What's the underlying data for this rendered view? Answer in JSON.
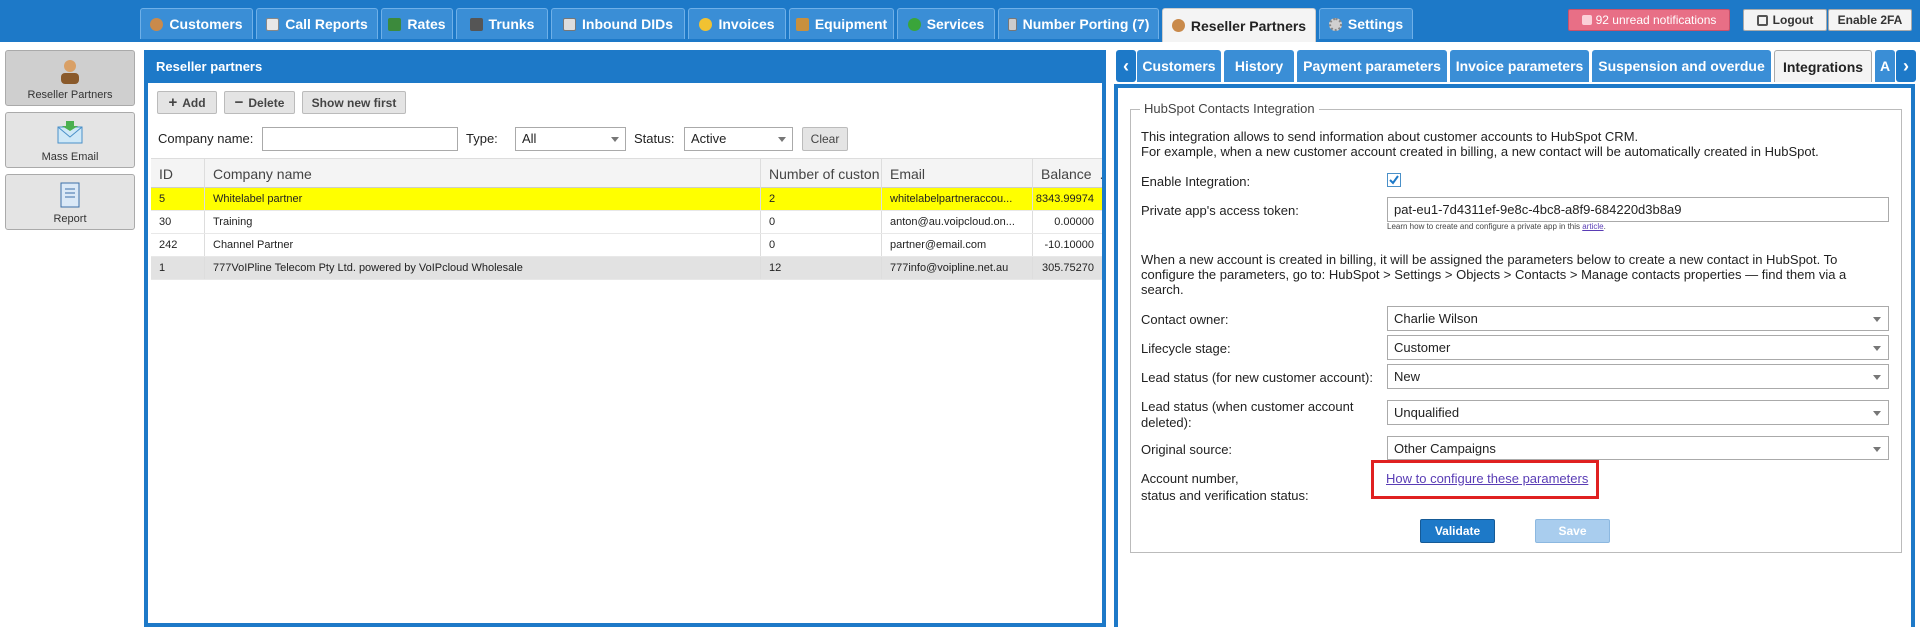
{
  "nav": {
    "tabs": [
      {
        "label": "Customers",
        "icon": "person-icon"
      },
      {
        "label": "Call Reports",
        "icon": "report-icon"
      },
      {
        "label": "Rates",
        "icon": "rates-icon"
      },
      {
        "label": "Trunks",
        "icon": "trunks-icon"
      },
      {
        "label": "Inbound DIDs",
        "icon": "list-icon"
      },
      {
        "label": "Invoices",
        "icon": "coins-icon"
      },
      {
        "label": "Equipment",
        "icon": "box-icon"
      },
      {
        "label": "Services",
        "icon": "refresh-icon"
      },
      {
        "label": "Number Porting (7)",
        "icon": "phone-icon"
      },
      {
        "label": "Reseller Partners",
        "icon": "person-icon"
      },
      {
        "label": "Settings",
        "icon": "gear-icon"
      }
    ],
    "active_tab": "Reseller Partners",
    "notifications": "92 unread notifications",
    "logout": "Logout",
    "enable_2fa": "Enable 2FA"
  },
  "sidebar": {
    "items": [
      {
        "label": "Reseller Partners"
      },
      {
        "label": "Mass Email"
      },
      {
        "label": "Report"
      }
    ]
  },
  "list_panel": {
    "title": "Reseller partners",
    "toolbar": {
      "add": "Add",
      "delete": "Delete",
      "show_new_first": "Show new first"
    },
    "filters": {
      "company_label": "Company name:",
      "company_value": "",
      "type_label": "Type:",
      "type_value": "All",
      "status_label": "Status:",
      "status_value": "Active",
      "clear": "Clear"
    },
    "columns": [
      "ID",
      "Company name",
      "Number of custon",
      "Email",
      "Balance"
    ],
    "rows": [
      {
        "id": "5",
        "company": "Whitelabel partner",
        "customers": "2",
        "email": "whitelabelpartneraccou...",
        "balance": "8343.99974"
      },
      {
        "id": "30",
        "company": "Training",
        "customers": "0",
        "email": "anton@au.voipcloud.on...",
        "balance": "0.00000"
      },
      {
        "id": "242",
        "company": "Channel Partner",
        "customers": "0",
        "email": "partner@email.com",
        "balance": "-10.10000"
      },
      {
        "id": "1",
        "company": "777VoIPline Telecom Pty Ltd. powered by VoIPcloud Wholesale",
        "customers": "12",
        "email": "777info@voipline.net.au",
        "balance": "305.75270"
      }
    ]
  },
  "detail_panel": {
    "tabs": [
      "Customers",
      "History",
      "Payment parameters",
      "Invoice parameters",
      "Suspension and overdue",
      "Integrations",
      "A"
    ],
    "active_tab": "Integrations",
    "legend": "HubSpot Contacts Integration",
    "intro_line1": "This integration allows to send information about customer accounts to HubSpot CRM.",
    "intro_line2": "For example, when a new customer account created in billing, a new contact will be automatically created in HubSpot.",
    "enable_label": "Enable Integration:",
    "enable_checked": true,
    "token_label": "Private app's access token:",
    "token_value": "pat-eu1-7d4311ef-9e8c-4bc8-a8f9-684220d3b8a9",
    "token_hint_prefix": "Learn how to create and configure a private app in this",
    "token_hint_link": "article",
    "token_hint_suffix": ".",
    "params_text": "When a new account is created in billing, it will be assigned the parameters below to create a new contact in HubSpot. To configure the parameters, go to: HubSpot > Settings > Objects > Contacts > Manage contacts properties — find them via a search.",
    "contact_owner_label": "Contact owner:",
    "contact_owner_value": "Charlie Wilson",
    "lifecycle_label": "Lifecycle stage:",
    "lifecycle_value": "Customer",
    "lead_new_label": "Lead status (for new customer account):",
    "lead_new_value": "New",
    "lead_deleted_label_1": "Lead status (when customer account",
    "lead_deleted_label_2": "deleted):",
    "lead_deleted_value": "Unqualified",
    "source_label": "Original source:",
    "source_value": "Other Campaigns",
    "account_label_1": "Account number,",
    "account_label_2": "status and verification status:",
    "configure_link": "How to configure these parameters",
    "validate": "Validate",
    "save": "Save"
  },
  "colors": {
    "primary_blue": "#1d79c8",
    "tab_blue": "#3a8ed6",
    "selected_row": "#ffff00",
    "notification": "#e86f86",
    "highlight_red": "#e02020",
    "link": "#5a3db5"
  }
}
